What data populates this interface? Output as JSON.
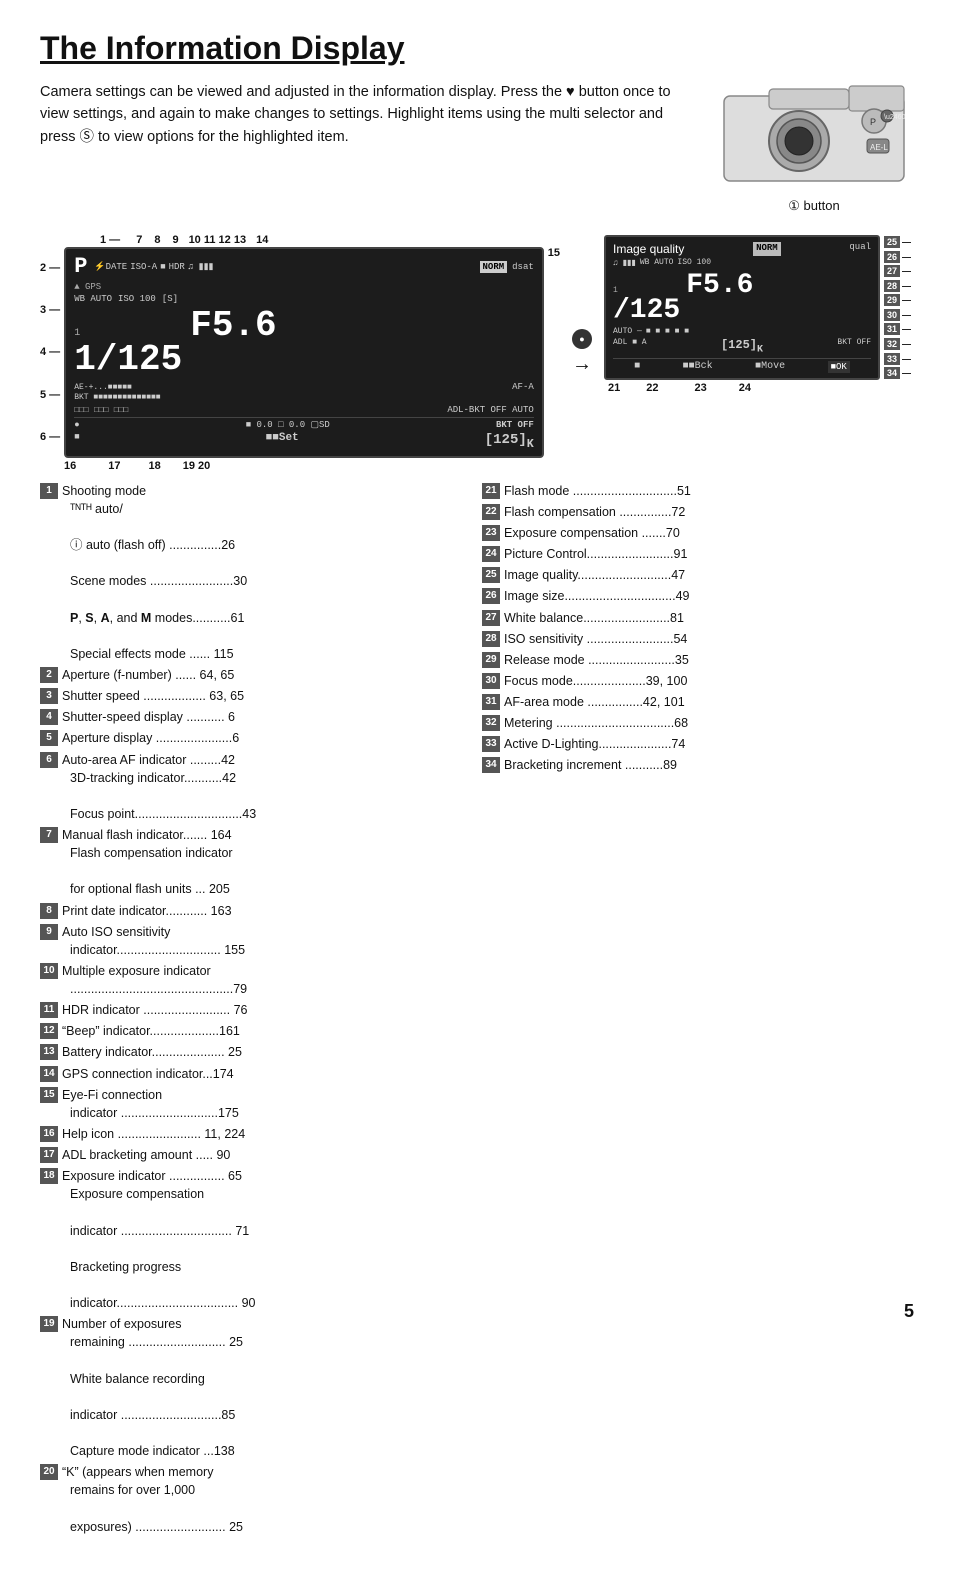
{
  "title": "The Information Display",
  "intro": "Camera settings can be viewed and adjusted in the information display.  Press the ♥ button once to view settings, and again to make changes to settings.  Highlight items using the multi selector and press Ⓢ to view options for the highlighted item.",
  "button_label": "① button",
  "diagram": {
    "top_callouts": [
      "1",
      "7",
      "8",
      "9",
      "10",
      "11",
      "12",
      "13",
      "14"
    ],
    "side_callouts_left": [
      "2",
      "3",
      "4",
      "5",
      "6"
    ],
    "bottom_callouts": [
      "16",
      "17",
      "18",
      "19",
      "20"
    ],
    "right_callouts": [
      "15"
    ],
    "shutter": "1/125",
    "aperture": "F5.6",
    "exposure_val": "125"
  },
  "right_panel_nums": [
    "25",
    "26",
    "27",
    "28",
    "29",
    "30",
    "31",
    "32",
    "33",
    "34"
  ],
  "image_quality_label": "Image quality",
  "right_screen": {
    "top_label": "Image quality",
    "norm": "NORM",
    "qual": "qual",
    "shutter": "1/125",
    "aperture": "F5.6",
    "val": "125",
    "wb": "WB",
    "auto": "AUTO",
    "iso_val": "100",
    "bottom_callouts": [
      "21",
      "22",
      "23",
      "24"
    ]
  },
  "references": {
    "col1": [
      {
        "num": "1",
        "text": "Shooting mode",
        "sub": [
          "ᴀᴜᴛᴏ auto/",
          "Ⓢ auto (flash off) ...............26",
          "Scene modes ........................30",
          "P, S, A, and M modes...........61",
          "Special effects mode ...... 115"
        ]
      },
      {
        "num": "2",
        "text": "Aperture (f-number) ...... 64, 65"
      },
      {
        "num": "3",
        "text": "Shutter speed .................. 63, 65"
      },
      {
        "num": "4",
        "text": "Shutter-speed display ........... 6"
      },
      {
        "num": "5",
        "text": "Aperture display ......................6"
      },
      {
        "num": "6",
        "text": "Auto-area AF indicator .........42",
        "sub": [
          "3D-tracking indicator...........42",
          "Focus point...............................43"
        ]
      },
      {
        "num": "7",
        "text": "Manual flash indicator....... 164",
        "sub": [
          "Flash compensation indicator",
          "for optional flash units ... 205"
        ]
      },
      {
        "num": "8",
        "text": "Print date indicator............ 163"
      },
      {
        "num": "9",
        "text": "Auto ISO sensitivity",
        "sub": [
          "indicator.............................. 155"
        ]
      },
      {
        "num": "10",
        "text": "Multiple exposure indicator",
        "sub": [
          "...............................................79"
        ]
      },
      {
        "num": "11",
        "text": "HDR indicator ......................... 76"
      },
      {
        "num": "12",
        "text": "“Beep” indicator....................161"
      },
      {
        "num": "13",
        "text": "Battery indicator..................... 25"
      },
      {
        "num": "14",
        "text": "GPS connection indicator...174"
      },
      {
        "num": "15",
        "text": "Eye-Fi connection",
        "sub": [
          "indicator ............................175"
        ]
      },
      {
        "num": "16",
        "text": "Help icon ........................ 11, 224"
      },
      {
        "num": "17",
        "text": "ADL bracketing amount ..... 90"
      },
      {
        "num": "18",
        "text": "Exposure indicator ................ 65",
        "sub": [
          "Exposure compensation",
          "indicator ................................ 71",
          "Bracketing progress",
          "indicator................................... 90"
        ]
      },
      {
        "num": "19",
        "text": "Number of exposures",
        "sub": [
          "remaining ............................ 25",
          "White balance recording",
          "indicator  .............................85",
          "Capture mode indicator  ...138"
        ]
      },
      {
        "num": "20",
        "text": "“K” (appears when memory",
        "sub": [
          "remains for over 1,000",
          "exposures) .......................... 25"
        ]
      }
    ],
    "col2": [
      {
        "num": "21",
        "text": "Flash mode ..............................51"
      },
      {
        "num": "22",
        "text": "Flash compensation ...............72"
      },
      {
        "num": "23",
        "text": "Exposure compensation .......70"
      },
      {
        "num": "24",
        "text": "Picture Control.........................91"
      },
      {
        "num": "25",
        "text": "Image quality...........................47"
      },
      {
        "num": "26",
        "text": "Image size................................49"
      },
      {
        "num": "27",
        "text": "White balance.........................81"
      },
      {
        "num": "28",
        "text": "ISO sensitivity .........................54"
      },
      {
        "num": "29",
        "text": "Release mode .........................35"
      },
      {
        "num": "30",
        "text": "Focus mode.....................39, 100"
      },
      {
        "num": "31",
        "text": "AF-area mode ................42, 101"
      },
      {
        "num": "32",
        "text": "Metering ..................................68"
      },
      {
        "num": "33",
        "text": "Active D-Lighting.....................74"
      },
      {
        "num": "34",
        "text": "Bracketing increment ...........89"
      }
    ]
  },
  "page_num": "5"
}
